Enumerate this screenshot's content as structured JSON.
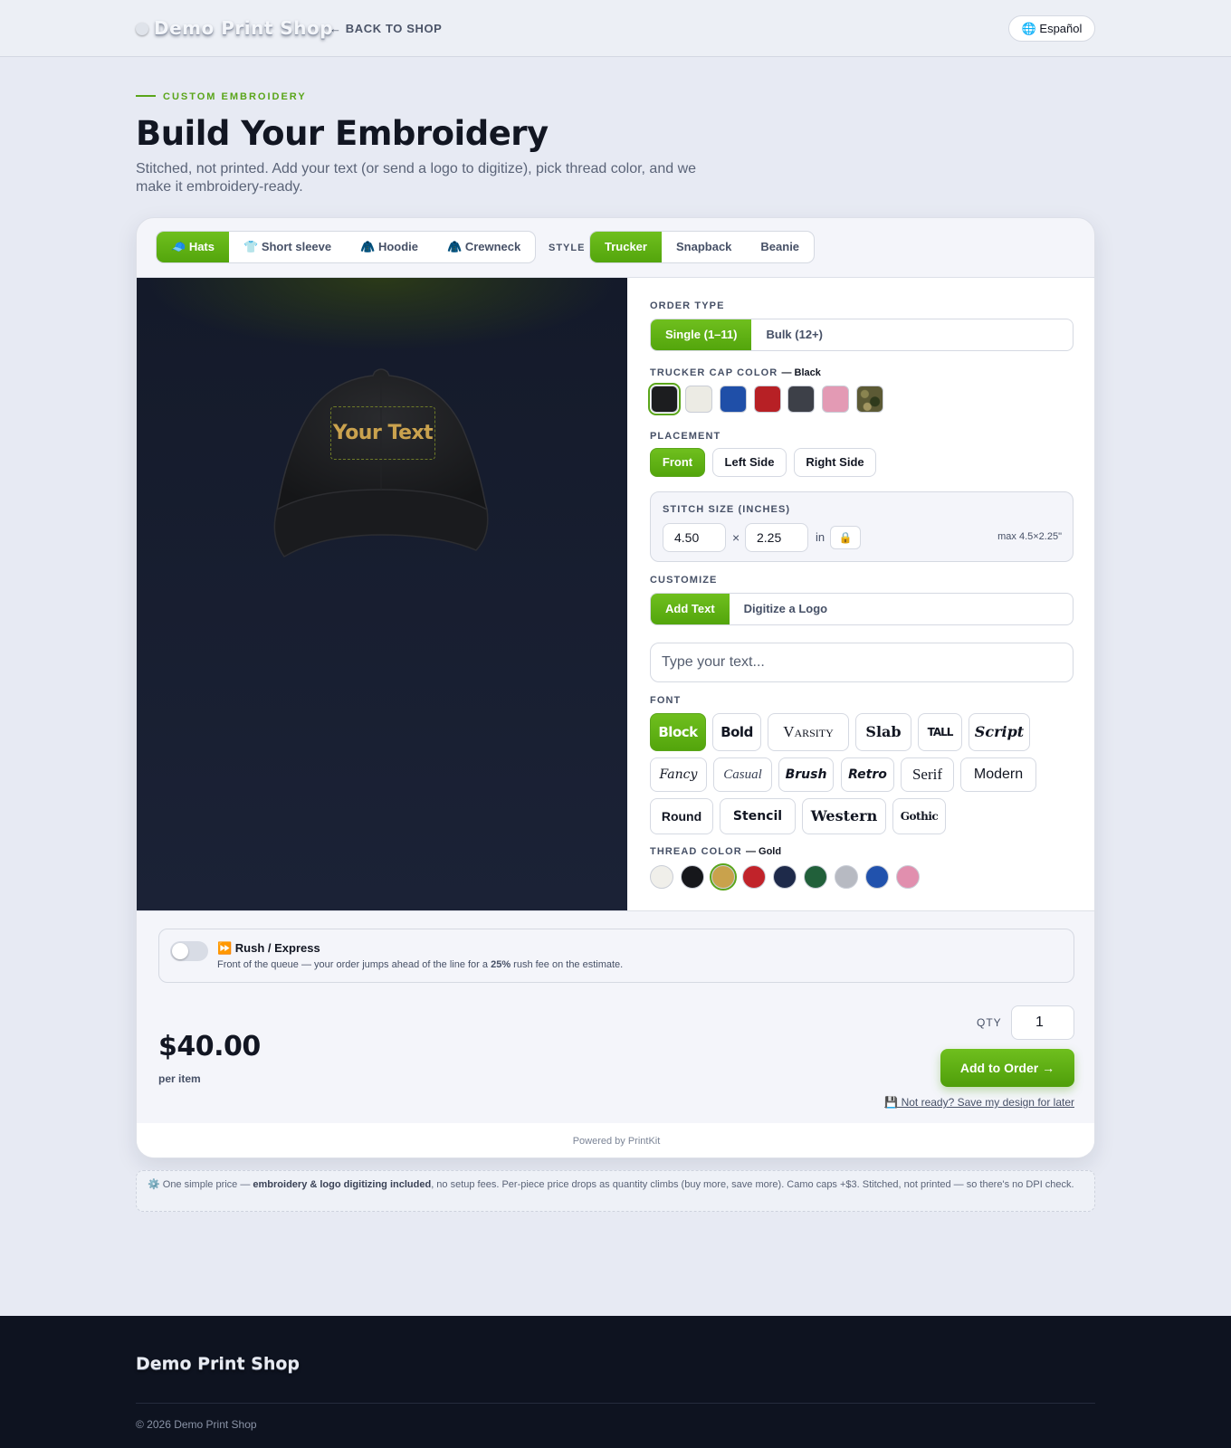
{
  "header": {
    "brand": "Demo Print Shop",
    "back_label": "← BACK TO SHOP",
    "language_label": "🌐 Español"
  },
  "hero": {
    "eyebrow": "CUSTOM EMBROIDERY",
    "title": "Build Your Embroidery",
    "subtitle": "Stitched, not printed. Add your text (or send a logo to digitize), pick thread color, and we make it embroidery-ready."
  },
  "product_tabs": [
    {
      "icon": "🧢",
      "label": "Hats",
      "active": true
    },
    {
      "icon": "👕",
      "label": "Short sleeve",
      "active": false
    },
    {
      "icon": "🧥",
      "label": "Hoodie",
      "active": false
    },
    {
      "icon": "🧥",
      "label": "Crewneck",
      "active": false
    }
  ],
  "style": {
    "label": "STYLE",
    "options": [
      {
        "label": "Trucker",
        "active": true
      },
      {
        "label": "Snapback",
        "active": false
      },
      {
        "label": "Beanie",
        "active": false
      }
    ]
  },
  "preview": {
    "embroidery_text": "Your Text",
    "thread_color": "#caa24e",
    "cap_color": "#1c1d1f"
  },
  "order_type": {
    "label": "ORDER TYPE",
    "options": [
      {
        "label": "Single (1–11)",
        "active": true
      },
      {
        "label": "Bulk (12+)",
        "active": false
      }
    ]
  },
  "cap_color": {
    "label": "TRUCKER CAP COLOR",
    "selected_name": "— Black",
    "swatches": [
      {
        "name": "black",
        "hex": "#1c1d1f",
        "selected": true
      },
      {
        "name": "white",
        "hex": "#ecebe4",
        "selected": false
      },
      {
        "name": "royal",
        "hex": "#1f4fa8",
        "selected": false
      },
      {
        "name": "red",
        "hex": "#b72025",
        "selected": false
      },
      {
        "name": "charcoal",
        "hex": "#3d4048",
        "selected": false
      },
      {
        "name": "pink",
        "hex": "#e39ab4",
        "selected": false
      },
      {
        "name": "camo",
        "hex": "#5c5a35",
        "selected": false
      }
    ]
  },
  "placement": {
    "label": "PLACEMENT",
    "options": [
      {
        "label": "Front",
        "active": true
      },
      {
        "label": "Left Side",
        "active": false
      },
      {
        "label": "Right Side",
        "active": false
      }
    ]
  },
  "stitch_size": {
    "label": "STITCH SIZE (INCHES)",
    "width": "4.50",
    "times": "×",
    "height": "2.25",
    "unit": "in",
    "lock_icon": "🔒",
    "max_label": "max 4.5×2.25\""
  },
  "customize": {
    "label": "CUSTOMIZE",
    "options": [
      {
        "label": "Add Text",
        "active": true
      },
      {
        "label": "Digitize a Logo",
        "active": false
      }
    ],
    "text_placeholder": "Type your text..."
  },
  "font": {
    "label": "FONT",
    "options": [
      {
        "label": "Block",
        "active": true
      },
      {
        "label": "Bold",
        "active": false
      },
      {
        "label": "Varsity",
        "active": false
      },
      {
        "label": "Slab",
        "active": false
      },
      {
        "label": "TALL",
        "active": false
      },
      {
        "label": "Script",
        "active": false
      },
      {
        "label": "Fancy",
        "active": false
      },
      {
        "label": "Casual",
        "active": false
      },
      {
        "label": "Brush",
        "active": false
      },
      {
        "label": "Retro",
        "active": false
      },
      {
        "label": "Serif",
        "active": false
      },
      {
        "label": "Modern",
        "active": false
      },
      {
        "label": "Round",
        "active": false
      },
      {
        "label": "Stencil",
        "active": false
      },
      {
        "label": "Western",
        "active": false
      },
      {
        "label": "Gothic",
        "active": false
      }
    ]
  },
  "thread_color": {
    "label": "THREAD COLOR",
    "selected_name": "— Gold",
    "swatches": [
      {
        "name": "white",
        "hex": "#f0efea",
        "selected": false
      },
      {
        "name": "black",
        "hex": "#16171b",
        "selected": false
      },
      {
        "name": "gold",
        "hex": "#c9a24c",
        "selected": true
      },
      {
        "name": "red",
        "hex": "#c1232a",
        "selected": false
      },
      {
        "name": "navy",
        "hex": "#1e2a4a",
        "selected": false
      },
      {
        "name": "green",
        "hex": "#21603a",
        "selected": false
      },
      {
        "name": "silver",
        "hex": "#b7bac2",
        "selected": false
      },
      {
        "name": "royal",
        "hex": "#2152ad",
        "selected": false
      },
      {
        "name": "pink",
        "hex": "#e18fae",
        "selected": false
      }
    ]
  },
  "rush": {
    "title": "⏩ Rush / Express",
    "desc_before": "Front of the queue — your order jumps ahead of the line for a ",
    "desc_bold": "25%",
    "desc_after": " rush fee on the estimate.",
    "enabled": false
  },
  "pricing": {
    "price": "$40.00",
    "per_label": "per item",
    "qty_label": "QTY",
    "qty_value": "1",
    "add_button": "Add to Order →",
    "save_link": "💾 Not ready? Save my design for later"
  },
  "powered_by": "Powered by PrintKit",
  "note": {
    "icon": "⚙️",
    "before": " One simple price — ",
    "bold": "embroidery & logo digitizing included",
    "after": ", no setup fees. Per-piece price drops as quantity climbs (buy more, save more). Camo caps +$3. Stitched, not printed — so there's no DPI check."
  },
  "footer": {
    "brand": "Demo Print Shop",
    "copyright": "© 2026 Demo Print Shop"
  },
  "colors": {
    "accent": "#5aa51a",
    "dark": "#0e1320"
  }
}
